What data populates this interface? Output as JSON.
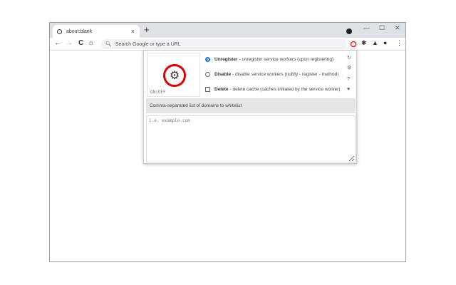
{
  "browser": {
    "tab_title": "about:blank",
    "new_tab": "+",
    "tab_close": "×",
    "minimize": "—",
    "maximize": "☐",
    "close": "✕",
    "back": "←",
    "forward": "→",
    "reload": "C",
    "home": "⌂",
    "omnibox_placeholder": "Search Google or type a URL",
    "menu": "⋮"
  },
  "popup": {
    "onoff": "ON|OFF",
    "options": [
      {
        "name": "Unregister",
        "desc": " - unregister service workers (upon registering)",
        "checked": true
      },
      {
        "name": "Disable",
        "desc": " - disable service workers (nullify - register - method)",
        "checked": false
      },
      {
        "name": "Delete",
        "desc": " - delete cache (caches initiated by the service worker)",
        "checked": false
      }
    ],
    "side_icons": [
      "reload-icon",
      "gear-icon",
      "help-icon",
      "heart-icon"
    ],
    "whitelist_label": "Comma-separated list of domains to whitelist",
    "whitelist_placeholder": "i.e. example.com",
    "accent": "#1a73e8",
    "brand": "#dd0000"
  }
}
